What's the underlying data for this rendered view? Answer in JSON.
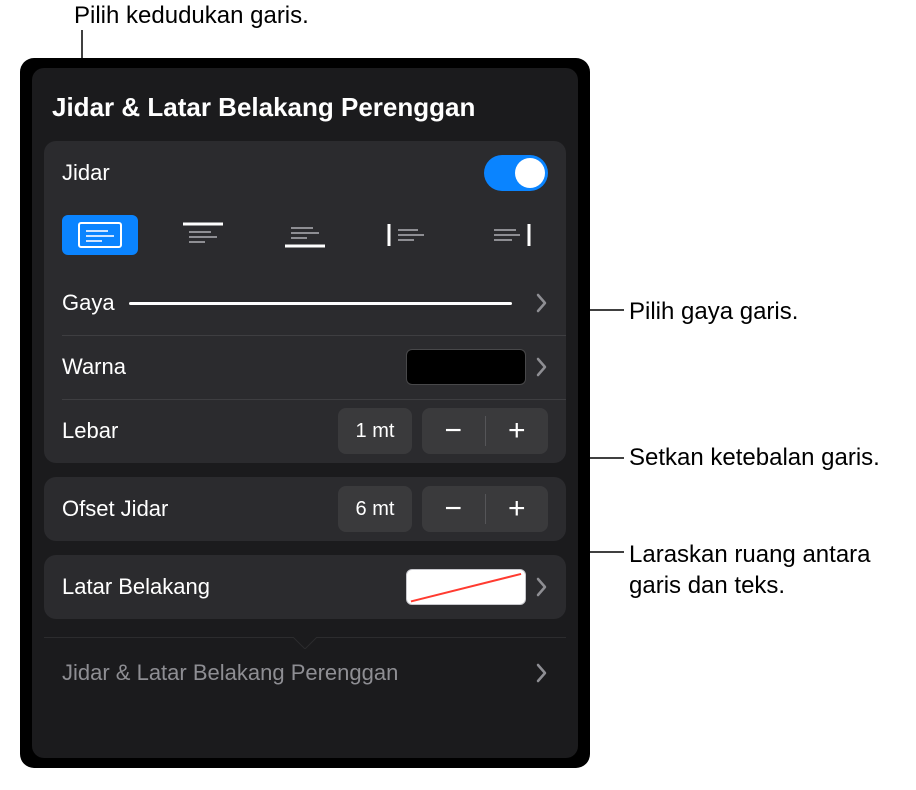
{
  "callouts": {
    "position": "Pilih kedudukan garis.",
    "style": "Pilih gaya garis.",
    "width": "Setkan ketebalan garis.",
    "offset": "Laraskan ruang antara garis dan teks."
  },
  "panel": {
    "title": "Jidar & Latar Belakang Perenggan",
    "border_toggle_label": "Jidar",
    "border_toggle_on": true,
    "positions": [
      "outline",
      "top",
      "bottom",
      "left",
      "right"
    ],
    "position_selected": 0,
    "style_label": "Gaya",
    "color_label": "Warna",
    "color_value": "#000000",
    "width_label": "Lebar",
    "width_value": "1 mt",
    "offset_label": "Ofset Jidar",
    "offset_value": "6 mt",
    "background_label": "Latar Belakang",
    "background_value": "none",
    "footer_label": "Jidar & Latar Belakang Perenggan",
    "stepper_minus": "−",
    "stepper_plus": "+"
  }
}
